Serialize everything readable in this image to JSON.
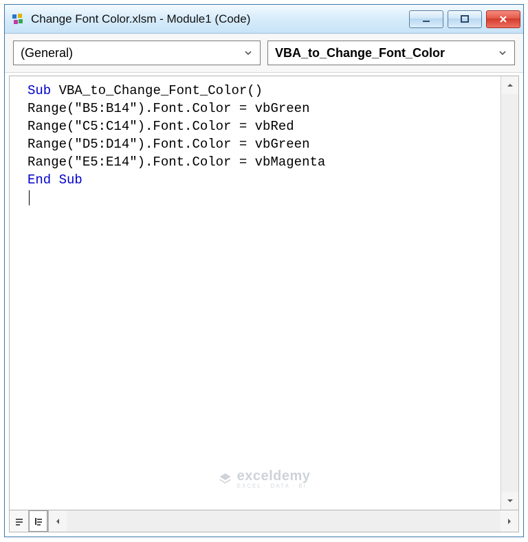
{
  "window": {
    "title": "Change Font Color.xlsm - Module1 (Code)"
  },
  "dropdowns": {
    "object": "(General)",
    "procedure": "VBA_to_Change_Font_Color"
  },
  "code": {
    "line1_kw": "Sub",
    "line1_rest": " VBA_to_Change_Font_Color()",
    "line2": "Range(\"B5:B14\").Font.Color = vbGreen",
    "line3": "Range(\"C5:C14\").Font.Color = vbRed",
    "line4": "Range(\"D5:D14\").Font.Color = vbGreen",
    "line5": "Range(\"E5:E14\").Font.Color = vbMagenta",
    "line6_kw": "End Sub"
  },
  "watermark": {
    "brand": "exceldemy",
    "sub": "EXCEL · DATA · BI"
  }
}
